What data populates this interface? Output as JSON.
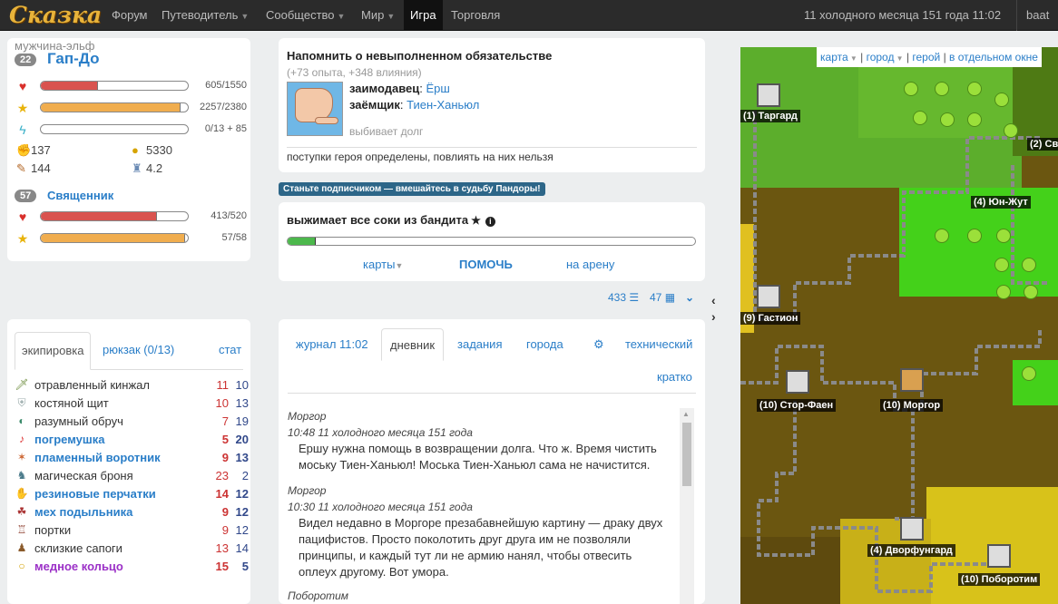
{
  "nav": {
    "logo": "Сказка",
    "items": [
      {
        "label": "Форум",
        "caret": false
      },
      {
        "label": "Путеводитель",
        "caret": true
      },
      {
        "label": "Сообщество",
        "caret": true
      },
      {
        "label": "Мир",
        "caret": true
      },
      {
        "label": "Игра",
        "caret": false,
        "active": true
      },
      {
        "label": "Торговля",
        "caret": false
      }
    ],
    "date": "11 холодного месяца 151 года 11:02",
    "user": "baat"
  },
  "hero": {
    "race": "мужчина-эльф",
    "level": "22",
    "name": "Гап-До",
    "stats": [
      {
        "icon": "heart-icon",
        "fraction": 0.39,
        "value": "605/1550",
        "color": "#d9534f"
      },
      {
        "icon": "star-icon",
        "fraction": 0.95,
        "value": "2257/2380",
        "color": "#f0ad4e"
      },
      {
        "icon": "energy-icon",
        "fraction": 0.0,
        "value": "0/13 + 85",
        "color": "#5bc0de"
      }
    ],
    "power": "137",
    "money": "5330",
    "magic": "144",
    "might": "4.2",
    "role_level": "57",
    "role_name": "Священник",
    "role_stats": [
      {
        "icon": "heart-icon",
        "fraction": 0.79,
        "value": "413/520",
        "color": "#d9534f"
      },
      {
        "icon": "star-icon",
        "fraction": 0.98,
        "value": "57/58",
        "color": "#f0ad4e"
      }
    ]
  },
  "equipment": {
    "tabs": [
      "экипировка",
      "рюкзак (0/13)",
      "стат"
    ],
    "items": [
      {
        "name": "отравленный кинжал",
        "a": "11",
        "b": "10",
        "kind": "normal"
      },
      {
        "name": "костяной щит",
        "a": "10",
        "b": "13",
        "kind": "normal"
      },
      {
        "name": "разумный обруч",
        "a": "7",
        "b": "19",
        "kind": "normal"
      },
      {
        "name": "погремушка",
        "a": "5",
        "b": "20",
        "kind": "rare"
      },
      {
        "name": "пламенный воротник",
        "a": "9",
        "b": "13",
        "kind": "rare"
      },
      {
        "name": "магическая броня",
        "a": "23",
        "b": "2",
        "kind": "normal"
      },
      {
        "name": "резиновые перчатки",
        "a": "14",
        "b": "12",
        "kind": "rare"
      },
      {
        "name": "мех подыльника",
        "a": "9",
        "b": "12",
        "kind": "rare"
      },
      {
        "name": "портки",
        "a": "9",
        "b": "12",
        "kind": "normal"
      },
      {
        "name": "склизкие сапоги",
        "a": "13",
        "b": "14",
        "kind": "normal"
      },
      {
        "name": "медное кольцо",
        "a": "15",
        "b": "5",
        "kind": "epic"
      }
    ]
  },
  "quest": {
    "title": "Напомнить о невыполненном обязательстве",
    "reward": "(+73 опыта, +348 влияния)",
    "lender_label": "заимодавец",
    "lender": "Ёрш",
    "borrower_label": "заёмщик",
    "borrower": "Тиен-Ханьюл",
    "action": "выбивает долг",
    "note": "поступки героя определены, повлиять на них нельзя"
  },
  "subscribe": "Станьте подписчиком — вмешайтесь в судьбу Пандоры!",
  "action": {
    "title": "выжимает все соки из бандита",
    "progress": 0.07,
    "cards": "карты",
    "help": "ПОМОЧЬ",
    "arena": "на арену"
  },
  "counters": {
    "a": "433",
    "b": "47"
  },
  "diary": {
    "tabs": [
      "журнал 11:02",
      "дневник",
      "задания",
      "города",
      "технический",
      "кратко"
    ],
    "entries": [
      {
        "who": "Моргор",
        "when": "10:48 11 холодного месяца 151 года",
        "text": "Ершу нужна помощь в возвращении долга. Что ж. Время чистить моську Тиен-Ханьюл! Моська Тиен-Ханьюл сама не начистится."
      },
      {
        "who": "Моргор",
        "when": "10:30 11 холодного месяца 151 года",
        "text": "Видел недавно в Моргоре презабавнейшую картину — драку двух пацифистов. Просто поколотить друг друга им не позволяли принципы, и каждый тут ли не армию нанял, чтобы отвесить оплеух другому. Вот умора."
      },
      {
        "who": "Поборотим",
        "when": "",
        "text": ""
      }
    ]
  },
  "map": {
    "links": [
      "карта",
      "город",
      "герой",
      "в отдельном окне"
    ],
    "towns": [
      "(1) Таргард",
      "(2) Св",
      "(4) Юн-Жут",
      "(9) Гастион",
      "(10) Стор-Фаен",
      "(10) Моргор",
      "(4) Дворфунгард",
      "(10) Поборотим"
    ]
  }
}
